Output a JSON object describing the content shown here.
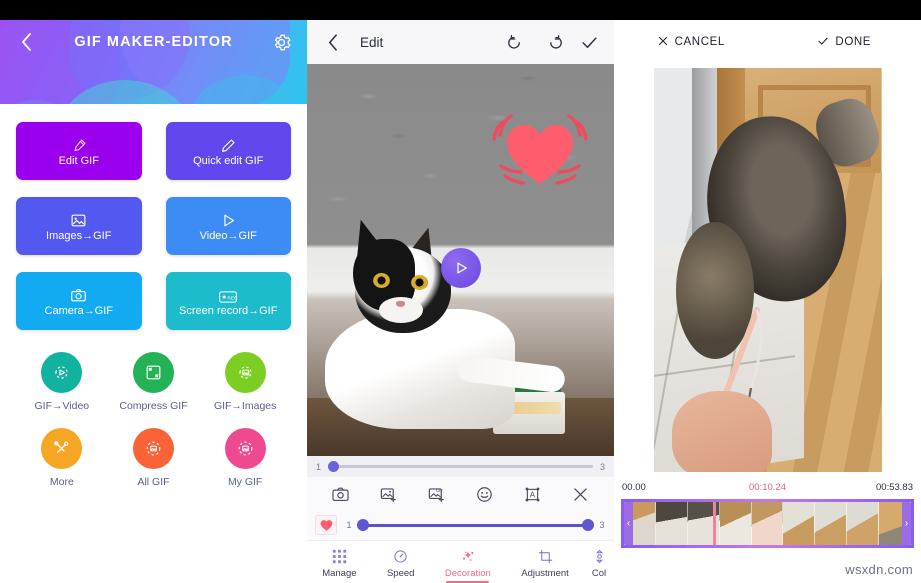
{
  "home": {
    "back_icon": "chevron-left-icon",
    "title": "GIF MAKER-EDITOR",
    "settings_icon": "gear-icon",
    "tiles": [
      {
        "label": "Edit GIF",
        "icon": "brush-icon",
        "color": "#9b00ee"
      },
      {
        "label": "Quick edit GIF",
        "icon": "pen-icon",
        "color": "#6347ee"
      },
      {
        "label": "Images→GIF",
        "icon": "image-icon",
        "color": "#5258f0"
      },
      {
        "label": "Video→GIF",
        "icon": "play-icon",
        "color": "#3d8bf5"
      },
      {
        "label": "Camera→GIF",
        "icon": "camera-icon",
        "color": "#12aaf0"
      },
      {
        "label": "Screen record→GIF",
        "icon": "rec-icon",
        "color": "#1cbccd"
      }
    ],
    "circles": [
      {
        "label": "GIF→Video",
        "icon": "gif-to-video-icon",
        "color": "#11b2a0"
      },
      {
        "label": "Compress GIF",
        "icon": "compress-icon",
        "color": "#23b256"
      },
      {
        "label": "GIF→Images",
        "icon": "gif-to-images-icon",
        "color": "#7cce22"
      },
      {
        "label": "More",
        "icon": "tools-icon",
        "color": "#f5a623"
      },
      {
        "label": "All GIF",
        "icon": "all-gif-icon",
        "color": "#fa6336"
      },
      {
        "label": "My GIF",
        "icon": "my-gif-icon",
        "color": "#ef4a8f"
      }
    ]
  },
  "editor": {
    "back_icon": "chevron-left-icon",
    "title": "Edit",
    "undo_icon": "undo-icon",
    "redo_icon": "redo-icon",
    "confirm_icon": "check-icon",
    "sticker": "heart-sticker",
    "play_icon": "play-icon",
    "frame_slider": {
      "min_label": "1",
      "max_label": "3",
      "value": 1
    },
    "tools": [
      {
        "name": "camera-icon"
      },
      {
        "name": "add-image-icon"
      },
      {
        "name": "add-gif-icon"
      },
      {
        "name": "sticker-icon"
      },
      {
        "name": "text-icon"
      },
      {
        "name": "close-icon"
      }
    ],
    "range": {
      "thumb": "heart-thumb",
      "min_label": "1",
      "max_label": "3",
      "start": 1,
      "end": 3
    },
    "tabs": [
      {
        "label": "Manage",
        "icon": "grid-icon",
        "active": false
      },
      {
        "label": "Speed",
        "icon": "speedometer-icon",
        "active": false
      },
      {
        "label": "Decoration",
        "icon": "sparkle-icon",
        "active": true
      },
      {
        "label": "Adjustment",
        "icon": "crop-icon",
        "active": false
      },
      {
        "label": "Col",
        "icon": "color-icon",
        "active": false
      }
    ]
  },
  "trimmer": {
    "cancel_label": "CANCEL",
    "cancel_icon": "close-icon",
    "done_label": "DONE",
    "done_icon": "check-icon",
    "time_start": "00.00",
    "time_current": "00:10.24",
    "time_end": "00:53.83",
    "handle_left_icon": "chevron-left-icon",
    "handle_right_icon": "chevron-right-icon",
    "frame_count": 9
  },
  "watermark": "wsxdn.com",
  "colors": {
    "accent_pink": "#f06a8a",
    "accent_purple": "#6056d2",
    "timeline_purple": "#8b5cf0"
  }
}
